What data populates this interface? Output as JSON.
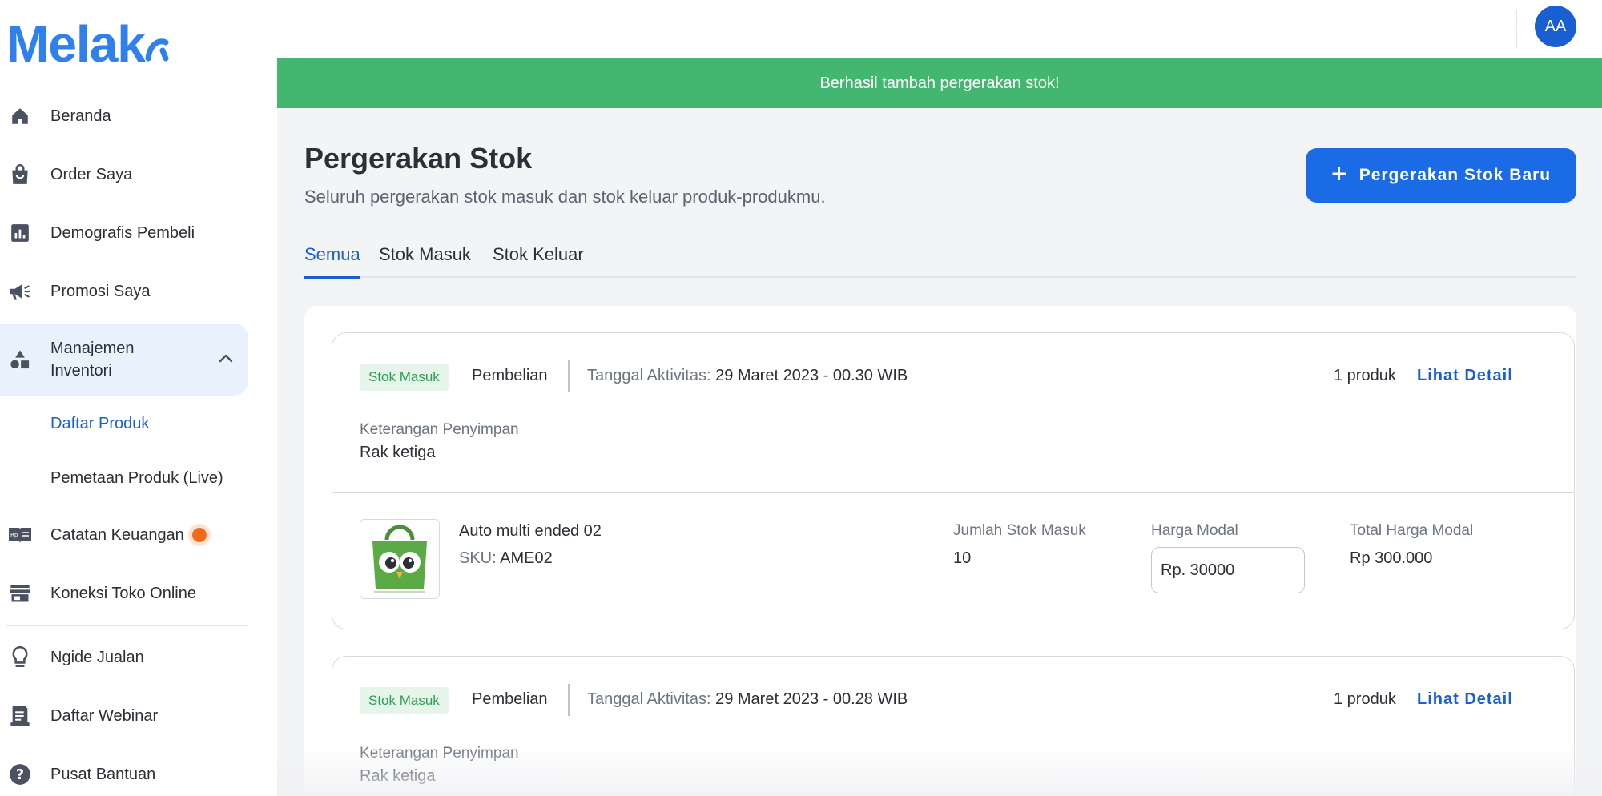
{
  "app": {
    "logo_text": "Melak"
  },
  "sidebar": {
    "items": [
      {
        "label": "Beranda",
        "icon": "home-icon"
      },
      {
        "label": "Order Saya",
        "icon": "shopping-bag-icon"
      },
      {
        "label": "Demografis Pembeli",
        "icon": "bar-chart-icon"
      },
      {
        "label": "Promosi Saya",
        "icon": "megaphone-icon"
      },
      {
        "label_line1": "Manajemen",
        "label_line2": "Inventori",
        "icon": "shapes-icon"
      },
      {
        "label": "Daftar Produk"
      },
      {
        "label": "Pemetaan Produk (Live)"
      },
      {
        "label": "Catatan Keuangan",
        "icon": "finance-book-icon"
      },
      {
        "label": "Koneksi Toko Online",
        "icon": "store-icon"
      },
      {
        "label": "Ngide Jualan",
        "icon": "lightbulb-icon"
      },
      {
        "label": "Daftar Webinar",
        "icon": "document-icon"
      },
      {
        "label": "Pusat Bantuan",
        "icon": "help-icon"
      }
    ]
  },
  "header": {
    "avatar_initials": "AA"
  },
  "toast": {
    "message": "Berhasil tambah pergerakan stok!"
  },
  "page": {
    "title": "Pergerakan Stok",
    "subtitle": "Seluruh pergerakan stok masuk dan stok keluar produk-produkmu.",
    "new_button_label": "Pergerakan Stok Baru",
    "tabs": [
      "Semua",
      "Stok Masuk",
      "Stok Keluar"
    ],
    "active_tab": "Semua"
  },
  "movements": [
    {
      "badge": "Stok Masuk",
      "type": "Pembelian",
      "date_label": "Tanggal Aktivitas:",
      "date_value": "29 Maret 2023 - 00.30 WIB",
      "count": "1 produk",
      "detail_label": "Lihat Detail",
      "note_label": "Keterangan Penyimpan",
      "note_value": "Rak ketiga",
      "product": {
        "name": "Auto multi ended 02",
        "sku_label": "SKU:",
        "sku": "AME02",
        "qty_label": "Jumlah Stok Masuk",
        "qty": "10",
        "price_label": "Harga Modal",
        "price_input": "Rp. 30000",
        "total_label": "Total Harga Modal",
        "total": "Rp 300.000"
      }
    },
    {
      "badge": "Stok Masuk",
      "type": "Pembelian",
      "date_label": "Tanggal Aktivitas:",
      "date_value": "29 Maret 2023 - 00.28 WIB",
      "count": "1 produk",
      "detail_label": "Lihat Detail",
      "note_label": "Keterangan Penyimpan",
      "note_value": "Rak ketiga"
    }
  ],
  "colors": {
    "brand": "#2f80ed",
    "primary": "#1a6be5",
    "success": "#43b66f",
    "badge_bg": "#e6f4ea",
    "badge_text": "#2f9e55",
    "notif_dot": "#f26b1d"
  }
}
